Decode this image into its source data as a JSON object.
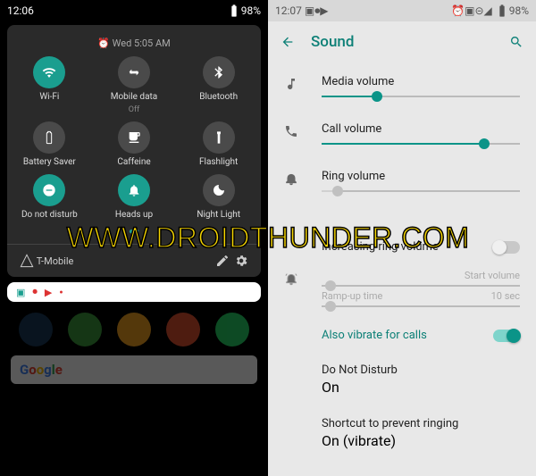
{
  "left": {
    "status": {
      "time": "12:06",
      "battery": "98%"
    },
    "qs_time": "Wed 5:05 AM",
    "tiles": [
      {
        "name": "wifi",
        "label": "Wi-Fi",
        "on": true,
        "icon": "wifi"
      },
      {
        "name": "mobiledata",
        "label": "Mobile data",
        "sub": "Off",
        "on": false,
        "icon": "swap"
      },
      {
        "name": "bluetooth",
        "label": "Bluetooth",
        "on": false,
        "icon": "bt"
      },
      {
        "name": "battery",
        "label": "Battery Saver",
        "on": false,
        "icon": "batt"
      },
      {
        "name": "caffeine",
        "label": "Caffeine",
        "on": false,
        "icon": "cup"
      },
      {
        "name": "flashlight",
        "label": "Flashlight",
        "on": false,
        "icon": "torch"
      },
      {
        "name": "dnd",
        "label": "Do not disturb",
        "on": true,
        "icon": "dnd"
      },
      {
        "name": "headsup",
        "label": "Heads up",
        "on": true,
        "icon": "bell"
      },
      {
        "name": "nightlight",
        "label": "Night Light",
        "on": false,
        "icon": "moon"
      }
    ],
    "carrier": "T-Mobile",
    "google": "Google"
  },
  "right": {
    "status": {
      "time": "12:07",
      "battery": "98%"
    },
    "title": "Sound",
    "media": {
      "label": "Media volume",
      "pct": 28
    },
    "call": {
      "label": "Call volume",
      "pct": 82
    },
    "ring": {
      "label": "Ring volume",
      "pct": 8
    },
    "incr": {
      "label": "Increasing ring volume",
      "on": false
    },
    "start": "Start volume",
    "ramp": {
      "label": "Ramp-up time",
      "val": "10 sec"
    },
    "vibc": {
      "label": "Also vibrate for calls",
      "on": true
    },
    "dnd": {
      "label": "Do Not Disturb",
      "sub": "On"
    },
    "short": {
      "label": "Shortcut to prevent ringing",
      "sub": "On (vibrate)"
    }
  },
  "watermark": "WWW.DROIDTHUNDER.COM"
}
